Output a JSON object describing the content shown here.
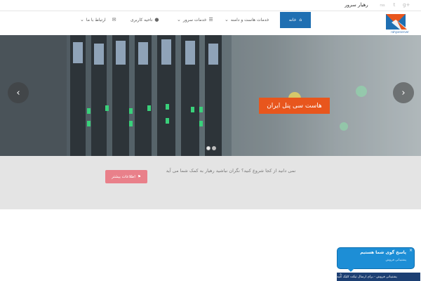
{
  "topbar": {
    "brand_text": "رهیار سرور",
    "social": [
      {
        "icon": "google-plus-icon",
        "glyph": "g+"
      },
      {
        "icon": "twitter-icon",
        "glyph": "t"
      },
      {
        "icon": "rss-icon",
        "glyph": "rss"
      }
    ]
  },
  "logo": {
    "caption": "rahyarserver",
    "accent_orange": "#e8561d",
    "accent_blue": "#1f6fb2"
  },
  "nav": {
    "home": {
      "label": "خانه",
      "icon": "home-icon"
    },
    "items": [
      {
        "label": "خدمات هاست و دامنه",
        "icon": "chevron-down-icon",
        "dropdown": true
      },
      {
        "label": "خدمات سرور",
        "icon": "list-icon",
        "dropdown": true
      },
      {
        "label": "ناحیه کاربری",
        "icon": "user-icon",
        "dropdown": false
      },
      {
        "label": "ارتباط با ما",
        "icon": "envelope-icon",
        "dropdown": true
      }
    ]
  },
  "slider": {
    "caption": "هاست سی پنل ایران",
    "prev_icon": "chevron-left-icon",
    "next_icon": "chevron-right-icon",
    "slide_count": 2,
    "active_slide": 1
  },
  "band": {
    "text": "نمی دانید از کجا شروع کنید؟ نگران نباشید رهیار به کمک شما می آید",
    "button_label": "اطلاعات بیشتر",
    "button_icon": "flag-icon",
    "button_color": "#e9808a"
  },
  "chat": {
    "title": "پاسخ گوی شما هستیم",
    "subtitle": "پشتیبانی فروش",
    "bar_text": "پشتیبانی فروش - برای ارسال تیکت کلیک کنید",
    "close_glyph": "×",
    "bubble_color": "#1d8ed6",
    "bar_color": "#1c3f73"
  }
}
